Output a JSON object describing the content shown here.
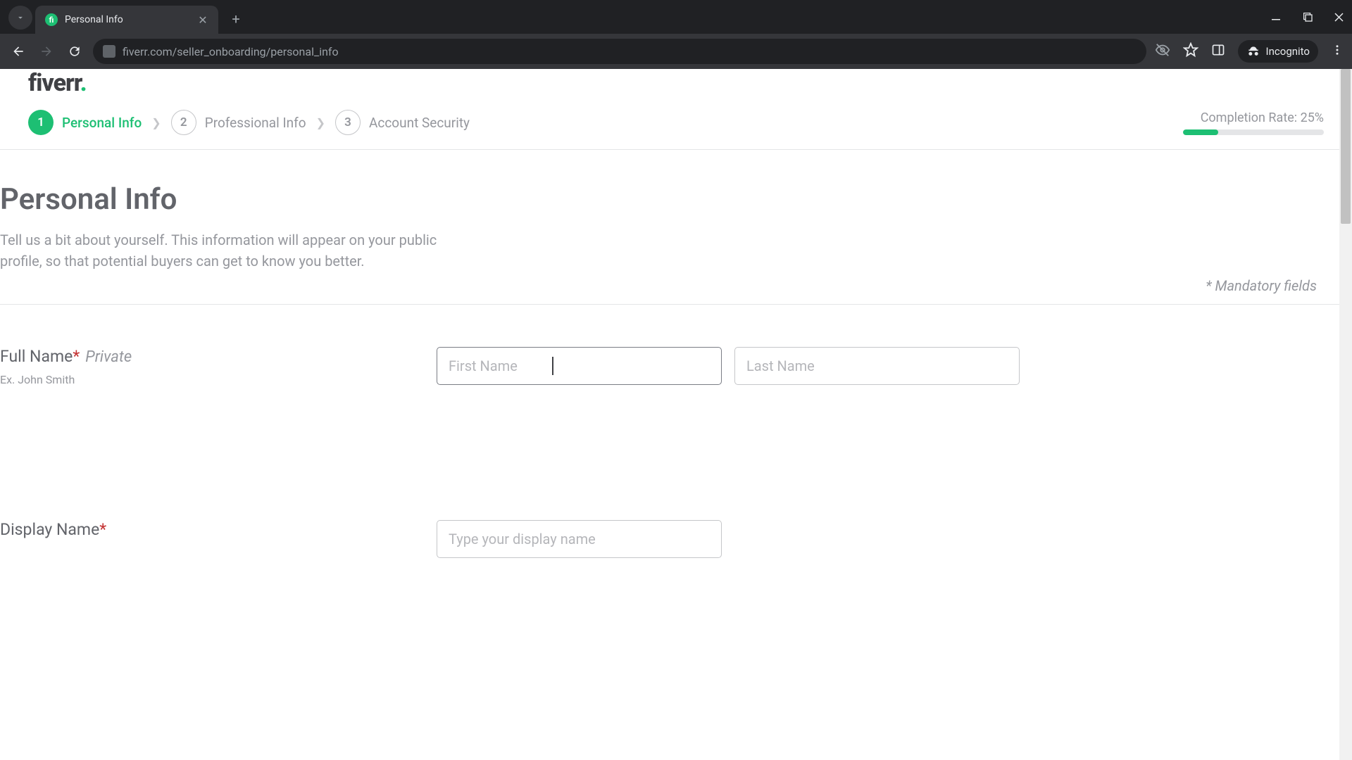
{
  "browser": {
    "tab_title": "Personal Info",
    "url": "fiverr.com/seller_onboarding/personal_info",
    "incognito_label": "Incognito"
  },
  "logo": {
    "text": "fiverr",
    "dot": "."
  },
  "stepper": {
    "steps": [
      {
        "num": "1",
        "label": "Personal Info"
      },
      {
        "num": "2",
        "label": "Professional Info"
      },
      {
        "num": "3",
        "label": "Account Security"
      }
    ]
  },
  "completion": {
    "label": "Completion Rate: 25%",
    "percent": 25
  },
  "header": {
    "title": "Personal Info",
    "subtitle": "Tell us a bit about yourself. This information will appear on your public profile, so that potential buyers can get to know you better.",
    "mandatory_note": "* Mandatory fields"
  },
  "form": {
    "full_name": {
      "label": "Full Name",
      "tag": "Private",
      "hint": "Ex. John Smith",
      "first_placeholder": "First Name",
      "last_placeholder": "Last Name",
      "first_value": "",
      "last_value": ""
    },
    "display_name": {
      "label": "Display Name",
      "placeholder": "Type your display name",
      "value": ""
    }
  }
}
